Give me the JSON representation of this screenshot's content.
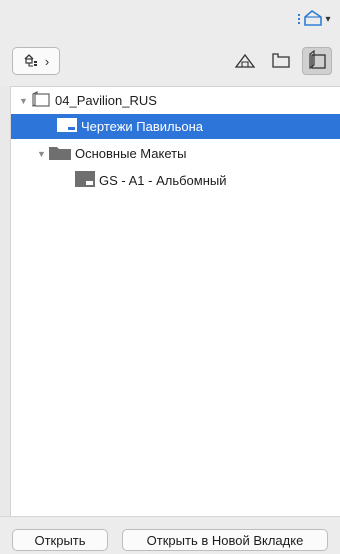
{
  "header": {
    "view_dropdown_icon": "layout-view-icon"
  },
  "toolbar": {
    "tree_button_icon": "tree-structure-icon",
    "view_icons": [
      "project-map-icon",
      "view-map-icon",
      "layout-book-icon"
    ]
  },
  "tree": {
    "project": {
      "label": "04_Pavilion_RUS"
    },
    "items": [
      {
        "label": "Чертежи Павильона",
        "selected": true
      },
      {
        "label": "Основные Макеты",
        "expanded": true
      },
      {
        "label": "GS - A1 - Альбомный"
      }
    ]
  },
  "footer": {
    "open_label": "Открыть",
    "open_new_tab_label": "Открыть в Новой Вкладке"
  },
  "colors": {
    "selection": "#2e75d9",
    "folder": "#6f6f6f"
  }
}
